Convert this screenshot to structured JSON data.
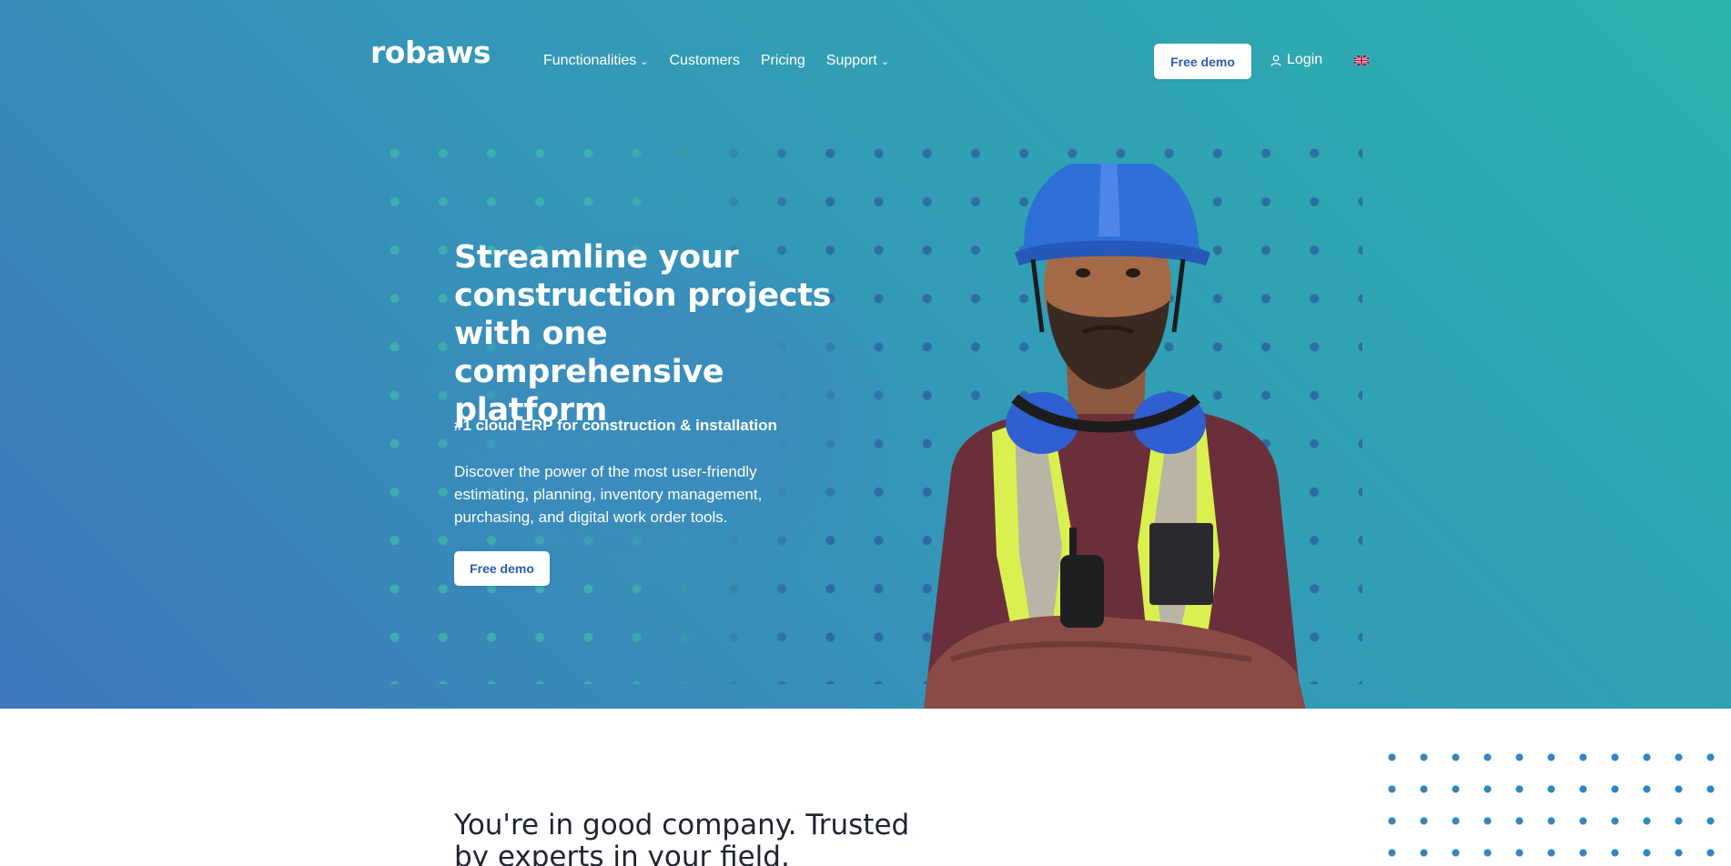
{
  "brand": {
    "logo_text": "robaws"
  },
  "nav": {
    "items": [
      {
        "label": "Functionalities",
        "has_dropdown": true
      },
      {
        "label": "Customers",
        "has_dropdown": false
      },
      {
        "label": "Pricing",
        "has_dropdown": false
      },
      {
        "label": "Support",
        "has_dropdown": true
      }
    ],
    "cta_label": "Free demo",
    "login_label": "Login",
    "language_icon": "uk-flag-icon"
  },
  "hero": {
    "headline": "Streamline your construction projects with one comprehensive platform",
    "subheadline": "#1 cloud ERP for construction & installation",
    "description": "Discover the power of the most user-friendly estimating, planning, inventory management, purchasing, and digital work order tools.",
    "cta_label": "Free demo",
    "image_icon": "construction-worker-image"
  },
  "social_proof": {
    "heading": "You're in good company. Trusted by experts in your field."
  },
  "colors": {
    "gradient_start": "#3f78bd",
    "gradient_end": "#2bb2ad",
    "button_text": "#2b5fa6",
    "vest": "#d9f050",
    "helmet": "#2f6fd8"
  }
}
